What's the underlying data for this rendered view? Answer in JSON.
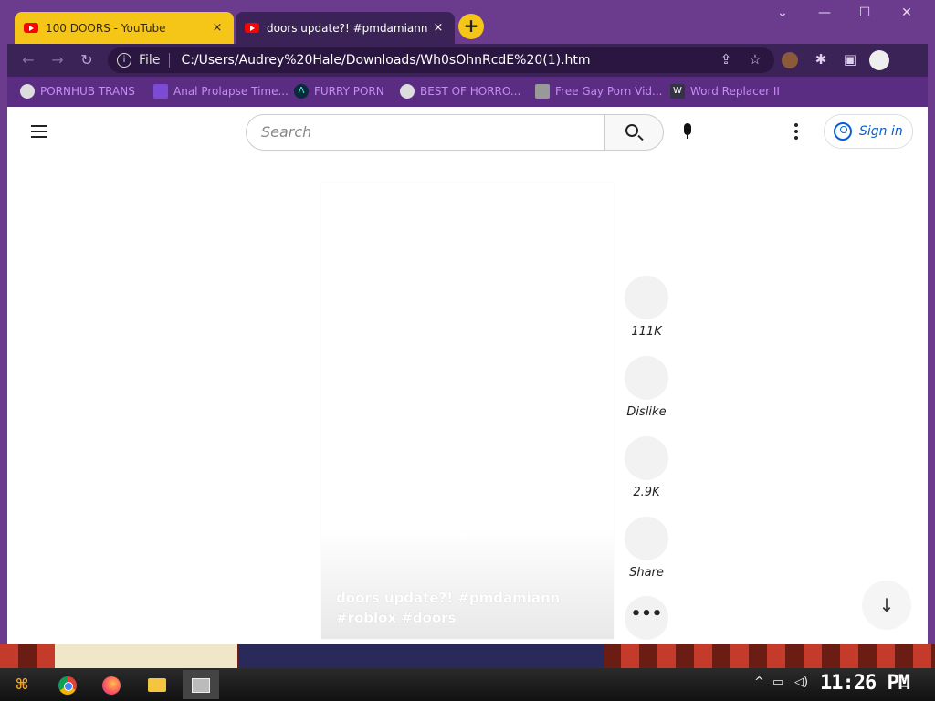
{
  "browser": {
    "tabs": [
      {
        "title": "100 DOORS - YouTube",
        "close": "×"
      },
      {
        "title": "doors update?! #pmdamiann #",
        "close": "×"
      }
    ],
    "new_tab": "+",
    "window_controls": {
      "list": "⌄",
      "minimize": "—",
      "maximize": "☐",
      "close": "✕"
    },
    "nav": {
      "back": "←",
      "forward": "→",
      "reload": "↻"
    },
    "address": {
      "info": "i",
      "scheme_label": "File",
      "url": "C:/Users/Audrey%20Hale/Downloads/Wh0sOhnRcdE%20(1).htm"
    },
    "toolbar_icons": {
      "share": "⇪",
      "star": "☆",
      "extensions": "✱",
      "sidepanel": "▣"
    },
    "bookmarks": [
      {
        "label": "PORNHUB TRANS",
        "icon": "globe-icon"
      },
      {
        "label": "Anal Prolapse Time...",
        "icon": "bookmark-icon"
      },
      {
        "label": "FURRY PORN",
        "icon": "lambda-icon"
      },
      {
        "label": "BEST OF HORRO...",
        "icon": "globe-icon"
      },
      {
        "label": "Free Gay Porn Vid...",
        "icon": "site-icon"
      },
      {
        "label": "Word Replacer II",
        "icon": "wr-icon"
      }
    ]
  },
  "youtube": {
    "search_placeholder": "Search",
    "sign_in": "Sign in",
    "short": {
      "caption": "doors update?! #pmdamiann #roblox #doors"
    },
    "actions": [
      {
        "name": "like",
        "label": "111K"
      },
      {
        "name": "dislike",
        "label": "Dislike"
      },
      {
        "name": "comments",
        "label": "2.9K"
      },
      {
        "name": "share",
        "label": "Share"
      }
    ],
    "more": "•••",
    "scroll_down": "↓"
  },
  "taskbar": {
    "tray": {
      "chevron": "^",
      "network": "▭",
      "volume": "◁)",
      "notifications": "▢"
    },
    "clock": "11:26 PM"
  }
}
